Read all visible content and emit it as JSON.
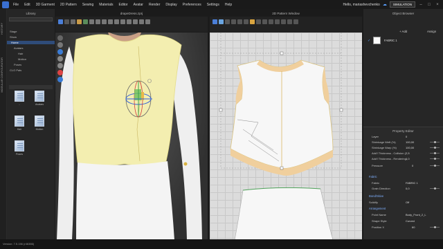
{
  "menubar": {
    "items": [
      "File",
      "Edit",
      "3D Garment",
      "2D Pattern",
      "Sewing",
      "Materials",
      "Editor",
      "Avatar",
      "Render",
      "Display",
      "Preferences",
      "Settings",
      "Help"
    ],
    "user": "Hello, mariashevchenko",
    "simulation_label": "SIMULATION"
  },
  "left_strip": {
    "top_tab": "HISTORY",
    "modular_tab": "MODULAR CONFIGURATOR"
  },
  "library": {
    "title": "Library",
    "tree": [
      "Stage",
      "Show",
      "Home",
      "Avatars",
      "Hair",
      "Motion",
      "Poses",
      "CLO Pals"
    ],
    "tiles": [
      "..",
      "Avatars",
      "Hair",
      "Motion",
      "Poses"
    ]
  },
  "view3d": {
    "title": "drapeDress.zprj"
  },
  "view2d": {
    "title": "2D Pattern Window"
  },
  "object_browser": {
    "title": "Object Browser",
    "add_label": "+ Add",
    "assign_label": "Assign",
    "fabric_name": "FABRIC 1"
  },
  "property_editor": {
    "title": "Property Editor",
    "rows": [
      {
        "k": "Layer",
        "v": "0"
      },
      {
        "k": "Shrinkage Weft (%)",
        "v": "100,00"
      },
      {
        "k": "Shrinkage Warp (%)",
        "v": "100,00"
      },
      {
        "k": "Add'l Thickness - Collision (",
        "v": "2,5"
      },
      {
        "k": "Add'l Thickness - Rendering",
        "v": "1,0"
      },
      {
        "k": "Pressure",
        "v": "0"
      }
    ],
    "fabric_section": "Fabric",
    "fabric_rows": [
      {
        "k": "Fabric",
        "v": "FABRIC 1"
      },
      {
        "k": "Grain Direction",
        "v": "0,0"
      }
    ],
    "bond_section": "Bond/Skive",
    "solidify": {
      "k": "Solidify",
      "v": "Off"
    },
    "arrangement_section": "Arrangement",
    "arrangement_rows": [
      {
        "k": "Point Name",
        "v": "Body_Front_2_L"
      },
      {
        "k": "Shape Style",
        "v": "Curved"
      },
      {
        "k": "Position X",
        "v": "60"
      }
    ]
  },
  "status": {
    "version": "Version: 7.5.156 (r46386)"
  },
  "colors": {
    "accent": "#3a6fd0",
    "shirt": "#f3eeb0",
    "sleeve": "#eeeeee",
    "pattern_edge": "#e8c99a"
  }
}
